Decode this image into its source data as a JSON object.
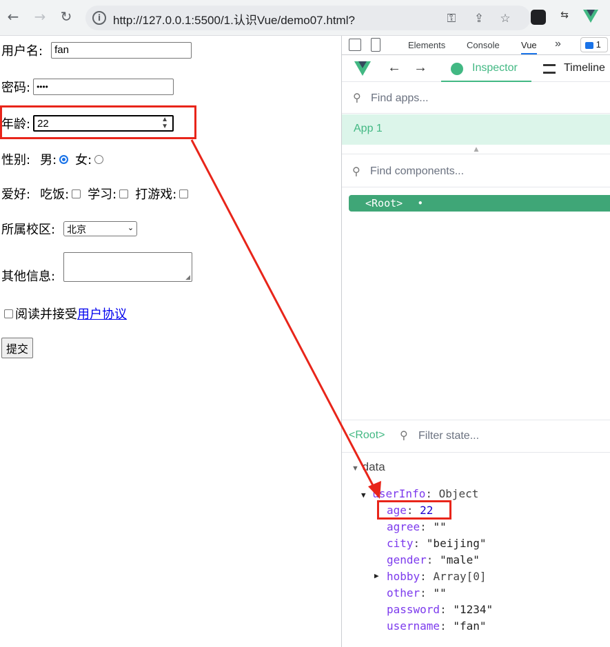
{
  "browser": {
    "url_host": "http://127.0.0.1",
    "url_rest": ":5500/1.认识Vue/demo07.html?"
  },
  "form": {
    "username_label": "用户名:",
    "username_value": "fan",
    "password_label": "密码:",
    "password_value": "••••",
    "age_label": "年龄:",
    "age_value": "22",
    "gender_label": "性别:",
    "male_label": "男:",
    "female_label": "女:",
    "hobby_label": "爱好:",
    "hobby_eat": "吃饭:",
    "hobby_study": "学习:",
    "hobby_game": "打游戏:",
    "campus_label": "所属校区:",
    "campus_value": "北京",
    "other_label": "其他信息:",
    "agree_text": "阅读并接受",
    "agree_link": "用户协议",
    "submit_label": "提交"
  },
  "devtools": {
    "tabs": [
      "Elements",
      "Console",
      "Vue"
    ],
    "active_tab": "Vue",
    "issues_count": "1",
    "inspector_label": "Inspector",
    "timeline_label": "Timeline",
    "find_apps_placeholder": "Find apps...",
    "app_name": "App 1",
    "find_components_placeholder": "Find components...",
    "root_label": "<Root>",
    "root_dot": "•",
    "state_root": "<Root>",
    "filter_placeholder": "Filter state...",
    "data_section": "data",
    "userinfo_key": "userInfo",
    "userinfo_type": "Object",
    "fields": [
      {
        "key": "age",
        "value": "22",
        "kind": "num"
      },
      {
        "key": "agree",
        "value": "\"\"",
        "kind": "str"
      },
      {
        "key": "city",
        "value": "\"beijing\"",
        "kind": "str"
      },
      {
        "key": "gender",
        "value": "\"male\"",
        "kind": "str"
      },
      {
        "key": "hobby",
        "value": "Array[0]",
        "kind": "obj"
      },
      {
        "key": "other",
        "value": "\"\"",
        "kind": "str"
      },
      {
        "key": "password",
        "value": "\"1234\"",
        "kind": "str"
      },
      {
        "key": "username",
        "value": "\"fan\"",
        "kind": "str"
      }
    ]
  },
  "colors": {
    "vue_green": "#42b883",
    "highlight_red": "#e8251a",
    "chrome_blue": "#1a73e8"
  }
}
